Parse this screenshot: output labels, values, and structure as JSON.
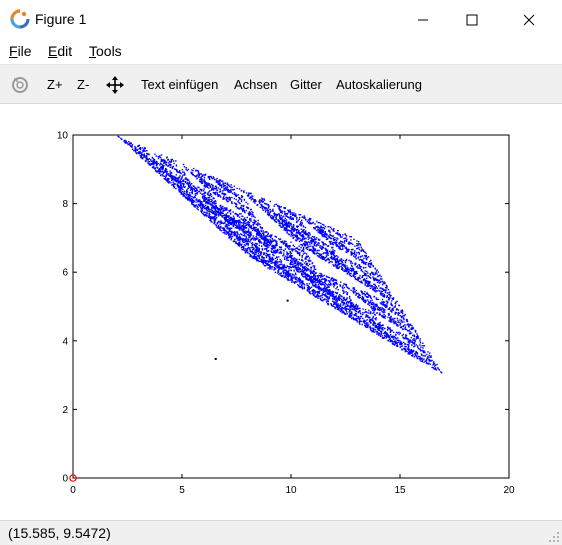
{
  "window": {
    "title": "Figure 1",
    "controls": [
      "minimize",
      "maximize",
      "close"
    ]
  },
  "menu": {
    "items": [
      {
        "label": "File",
        "accel": "F",
        "rest": "ile"
      },
      {
        "label": "Edit",
        "accel": "E",
        "rest": "dit"
      },
      {
        "label": "Tools",
        "accel": "T",
        "rest": "ools"
      }
    ]
  },
  "toolbar": {
    "rotate_icon": "rotate-icon",
    "zoom_in_label": "Z+",
    "zoom_out_label": "Z-",
    "pan_icon": "pan-arrows-icon",
    "insert_text_label": "Text einfügen",
    "axes_label": "Achsen",
    "grid_label": "Gitter",
    "autoscale_label": "Autoskalierung"
  },
  "status": {
    "coordinates": "(15.585, 9.5472)"
  },
  "colors": {
    "series": "#0000ff",
    "stray_points": "#000000",
    "origin_marker": "#ff0000"
  },
  "chart_data": {
    "type": "scatter",
    "title": "",
    "xlabel": "",
    "ylabel": "",
    "xlim": [
      0,
      20
    ],
    "ylim": [
      0,
      10
    ],
    "x_ticks": [
      0,
      5,
      10,
      15,
      20
    ],
    "y_ticks": [
      0,
      2,
      4,
      6,
      8,
      10
    ],
    "grid": false,
    "series": [
      {
        "description_points": "dense fractal point cloud (chaos-game attractor)",
        "color": "#0000ff",
        "attractor_vertices": [
          [
            2,
            10
          ],
          [
            13,
            7
          ],
          [
            17,
            3
          ],
          [
            8,
            6.5
          ]
        ],
        "outline_polygon": [
          [
            2,
            10
          ],
          [
            13,
            7
          ],
          [
            17,
            3
          ],
          [
            14.5,
            4.5
          ],
          [
            8,
            6.5
          ],
          [
            4,
            9
          ]
        ]
      }
    ],
    "stray_points": [
      [
        6.5,
        3.5
      ],
      [
        9.8,
        5.2
      ]
    ],
    "origin_marker": [
      0,
      0
    ]
  }
}
